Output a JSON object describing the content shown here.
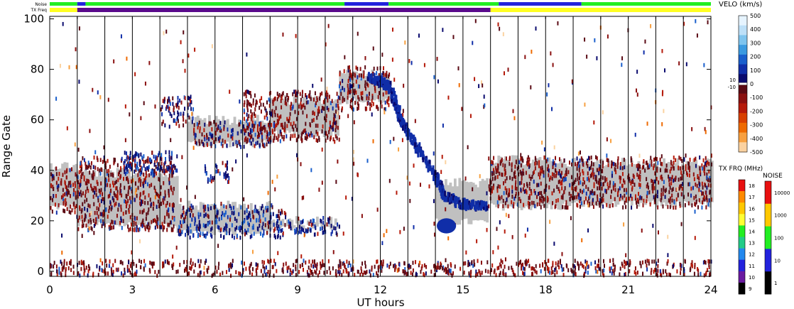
{
  "chart_data": {
    "type": "heatmap",
    "xlabel": "UT hours",
    "ylabel": "Range Gate",
    "xlim": [
      0,
      24
    ],
    "ylim": [
      -2,
      101
    ],
    "xticks": [
      0,
      3,
      6,
      9,
      12,
      15,
      18,
      21,
      24
    ],
    "yticks": [
      0,
      20,
      40,
      60,
      80,
      100
    ],
    "grid": "vertical lines every hour",
    "ground_scatter_color": "#c0c0c0",
    "noise_label": "Noise",
    "txfreq_label": "TX Freq",
    "noise_bar": [
      {
        "x0": 0,
        "x1": 1.0,
        "color": "#22ee22"
      },
      {
        "x0": 1.0,
        "x1": 1.3,
        "color": "#2222dd"
      },
      {
        "x0": 1.3,
        "x1": 10.7,
        "color": "#22ee22"
      },
      {
        "x0": 10.7,
        "x1": 12.3,
        "color": "#2222dd"
      },
      {
        "x0": 12.3,
        "x1": 16.3,
        "color": "#22ee22"
      },
      {
        "x0": 16.3,
        "x1": 19.3,
        "color": "#2222dd"
      },
      {
        "x0": 19.3,
        "x1": 24,
        "color": "#22ee22"
      }
    ],
    "txfreq_bar": [
      {
        "x0": 0,
        "x1": 1.0,
        "color": "#ffff22"
      },
      {
        "x0": 1.0,
        "x1": 16.0,
        "color": "#5a0a8c"
      },
      {
        "x0": 16.0,
        "x1": 24,
        "color": "#ffff22"
      }
    ],
    "ground_scatter_regions": [
      {
        "x0": 0,
        "x1": 1.0,
        "y0": 24,
        "y1": 44
      },
      {
        "x0": 1.0,
        "x1": 4.6,
        "y0": 17,
        "y1": 41
      },
      {
        "x0": 4.6,
        "x1": 8.0,
        "y0": 14,
        "y1": 28
      },
      {
        "x0": 8.0,
        "x1": 10.5,
        "y0": 16,
        "y1": 22
      },
      {
        "x0": 5.0,
        "x1": 8.0,
        "y0": 49,
        "y1": 62
      },
      {
        "x0": 8.0,
        "x1": 10.5,
        "y0": 53,
        "y1": 70
      },
      {
        "x0": 10.5,
        "x1": 12.3,
        "y0": 66,
        "y1": 80
      },
      {
        "x0": 14.0,
        "x1": 15.9,
        "y0": 18,
        "y1": 37
      },
      {
        "x0": 16.0,
        "x1": 18.5,
        "y0": 24,
        "y1": 46
      },
      {
        "x0": 18.5,
        "x1": 24,
        "y0": 25,
        "y1": 45
      }
    ],
    "echo_bands": [
      {
        "x0": 0,
        "x1": 1.0,
        "y0": 24,
        "y1": 42,
        "mix": "red"
      },
      {
        "x0": 1.0,
        "x1": 4.5,
        "y0": 17,
        "y1": 46,
        "mix": "red"
      },
      {
        "x0": 2.5,
        "x1": 4.6,
        "y0": 39,
        "y1": 48,
        "mix": "blue"
      },
      {
        "x0": 4.0,
        "x1": 5.2,
        "y0": 58,
        "y1": 70,
        "mix": "mixed"
      },
      {
        "x0": 5.2,
        "x1": 8.0,
        "y0": 50,
        "y1": 60,
        "mix": "mixed"
      },
      {
        "x0": 7.0,
        "x1": 10.5,
        "y0": 52,
        "y1": 72,
        "mix": "red"
      },
      {
        "x0": 4.6,
        "x1": 8.6,
        "y0": 14,
        "y1": 27,
        "mix": "blue"
      },
      {
        "x0": 8.6,
        "x1": 10.5,
        "y0": 15,
        "y1": 22,
        "mix": "blue"
      },
      {
        "x0": 5.6,
        "x1": 6.5,
        "y0": 36,
        "y1": 44,
        "mix": "blue"
      },
      {
        "x0": 10.5,
        "x1": 12.3,
        "y0": 64,
        "y1": 82,
        "mix": "red"
      },
      {
        "x0": 15.9,
        "x1": 24,
        "y0": 26,
        "y1": 46,
        "mix": "red"
      },
      {
        "x0": 0,
        "x1": 24,
        "y0": -1,
        "y1": 5,
        "mix": "red"
      }
    ],
    "blue_track": [
      [
        11.5,
        78
      ],
      [
        12.0,
        76
      ],
      [
        12.3,
        74
      ],
      [
        12.5,
        68
      ],
      [
        12.7,
        62
      ],
      [
        13.0,
        55
      ],
      [
        13.5,
        47
      ],
      [
        14.0,
        38
      ],
      [
        14.3,
        31
      ],
      [
        14.8,
        28
      ],
      [
        15.3,
        27
      ],
      [
        15.8,
        27
      ]
    ],
    "blue_blob": {
      "x": 14.4,
      "y": 18,
      "w": 0.7,
      "h": 6
    },
    "velocity_colorbar": {
      "label": "VELO (km/s)",
      "ticks": [
        500,
        400,
        300,
        200,
        100,
        0,
        -100,
        -200,
        -300,
        -400,
        -500
      ],
      "zero_labels": [
        "10",
        "-10"
      ],
      "colors": [
        "#e6f4ff",
        "#bde0f8",
        "#7ec4ee",
        "#3b9ae0",
        "#1a5fcc",
        "#102ea8",
        "#0a0a6e",
        "#5a0a14",
        "#8a1010",
        "#b51a0a",
        "#d84000",
        "#ee6a00",
        "#f7a040",
        "#fbd2a0"
      ]
    },
    "txfreq_colorbar": {
      "label": "TX FRQ (MHz)",
      "ticks": [
        "18",
        "17",
        "16",
        "15",
        "14",
        "13",
        "12",
        "11",
        "10",
        "9"
      ],
      "colors": [
        "#e81010",
        "#ff8a00",
        "#ffc800",
        "#ffff33",
        "#22ee22",
        "#22cc88",
        "#2288ee",
        "#2222dd",
        "#6a1aa0",
        "#000000"
      ]
    },
    "noise_colorbar": {
      "label": "NOISE",
      "ticks": [
        "10000",
        "1000",
        "100",
        "10",
        "1"
      ],
      "colors": [
        "#e81010",
        "#ffc800",
        "#22ee22",
        "#2222dd",
        "#000000"
      ]
    }
  }
}
